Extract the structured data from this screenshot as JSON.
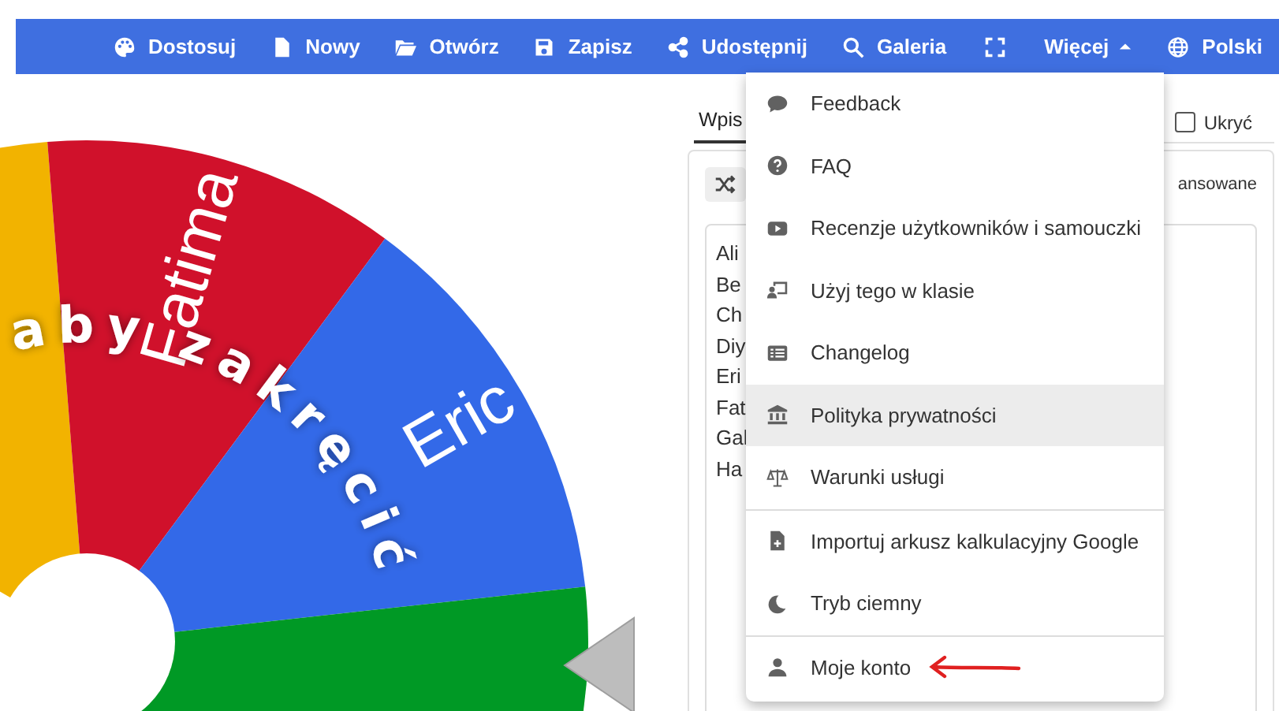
{
  "toolbar": {
    "items": [
      {
        "kind": "button",
        "label": "Dostosuj"
      },
      {
        "kind": "button",
        "label": "Nowy"
      },
      {
        "kind": "button",
        "label": "Otwórz"
      },
      {
        "kind": "button",
        "label": "Zapisz"
      },
      {
        "kind": "button",
        "label": "Udostępnij"
      },
      {
        "kind": "button",
        "label": "Galeria"
      },
      {
        "kind": "icon_button"
      },
      {
        "kind": "dropdown",
        "label": "Więcej",
        "expanded": true
      },
      {
        "kind": "button",
        "label": "Polski"
      }
    ]
  },
  "wheel": {
    "overlay_text": "aby zakręcić",
    "segments": [
      {
        "color": "#f2b300"
      },
      {
        "label": "Fatima",
        "color": "#d0112b"
      },
      {
        "label": "Eric",
        "color": "#3369e8"
      },
      {
        "color": "#009925"
      }
    ]
  },
  "panel": {
    "tabs": [
      {
        "label": "Wpis",
        "selected": true
      }
    ],
    "hide_checkbox": {
      "label": "Ukryć",
      "checked": false
    },
    "advanced_label": "ansowane",
    "entries": [
      "Ali",
      "Be",
      "Ch",
      "Diy",
      "Eri",
      "Fat",
      "Gal",
      "Ha"
    ]
  },
  "menu": {
    "items": [
      {
        "label": "Feedback",
        "highlighted": false,
        "divider_after": false
      },
      {
        "label": "FAQ",
        "highlighted": false,
        "divider_after": false
      },
      {
        "label": "Recenzje użytkowników i samouczki",
        "highlighted": false,
        "divider_after": false
      },
      {
        "label": "Użyj tego w klasie",
        "highlighted": false,
        "divider_after": false
      },
      {
        "label": "Changelog",
        "highlighted": false,
        "divider_after": false
      },
      {
        "label": "Polityka prywatności",
        "highlighted": true,
        "divider_after": false
      },
      {
        "label": "Warunki usługi",
        "highlighted": false,
        "divider_after": true
      },
      {
        "label": "Importuj arkusz kalkulacyjny Google",
        "highlighted": false,
        "divider_after": false
      },
      {
        "label": "Tryb ciemny",
        "highlighted": false,
        "divider_after": true
      },
      {
        "label": "Moje konto",
        "highlighted": false,
        "divider_after": false
      }
    ]
  }
}
